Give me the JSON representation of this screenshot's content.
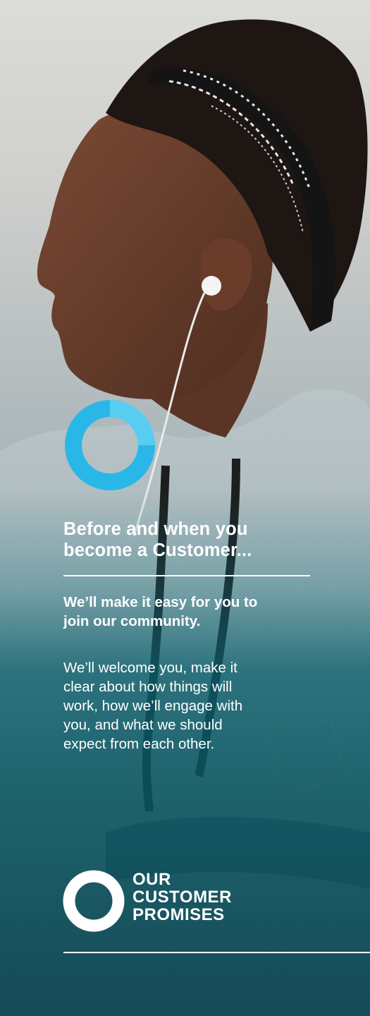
{
  "heading_lines": [
    "Before and when you",
    "become a Customer..."
  ],
  "subheading_lines": [
    "We’ll make it easy for you to",
    "join our community."
  ],
  "body_lines": [
    "We’ll welcome you, make it",
    "clear about how things will",
    "work, how we’ll engage with",
    "you, and what we should",
    "expect from each other."
  ],
  "brand_lines": [
    "OUR",
    "CUSTOMER",
    "PROMISES"
  ],
  "progress_ring": {
    "fraction": 0.25,
    "primary_color": "#29b7e8",
    "accent_color": "#58cdf2"
  },
  "colors": {
    "text": "#ffffff",
    "teal": "#0f5f6b"
  }
}
